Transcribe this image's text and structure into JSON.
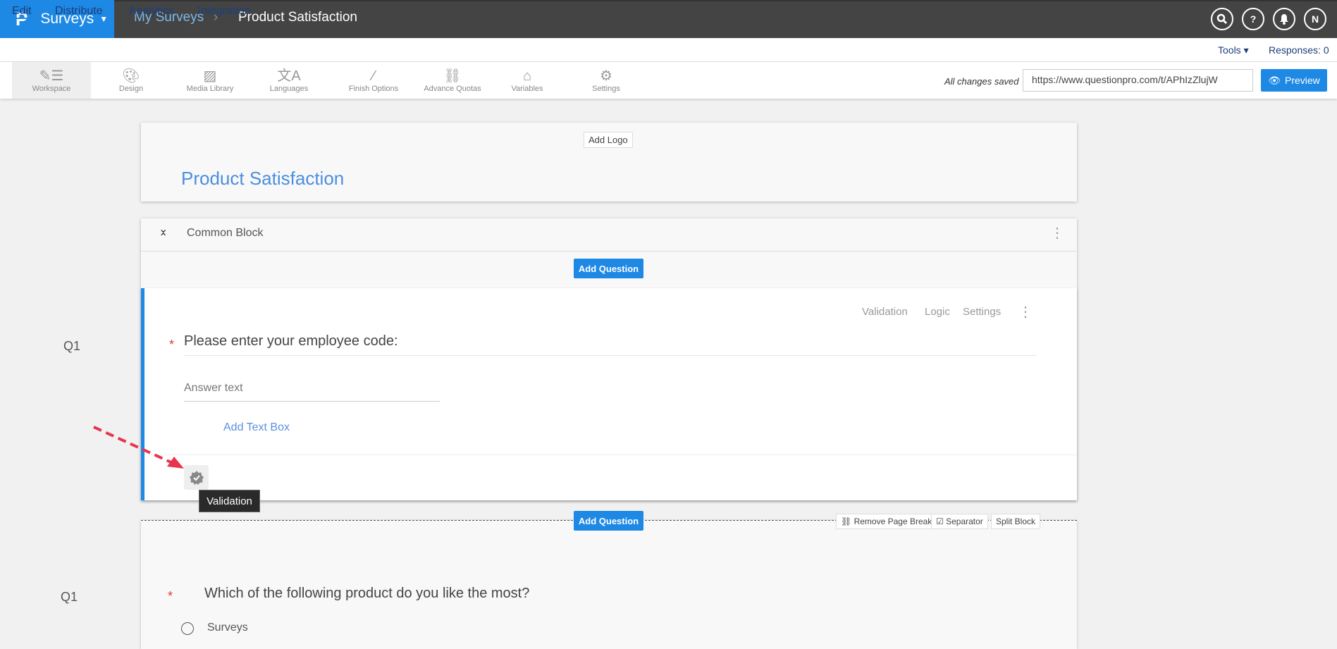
{
  "topbar": {
    "brand": "Surveys",
    "breadcrumb": [
      "My Surveys",
      "Product Satisfaction"
    ],
    "icons": [
      "search-icon",
      "help-icon",
      "bell-icon"
    ],
    "avatar": "N"
  },
  "nav": {
    "tabs": [
      "Edit",
      "Distribute",
      "Analytics",
      "Integration"
    ],
    "tools": "Tools",
    "responses": "Responses: 0"
  },
  "toolbar": {
    "items": [
      "Workspace",
      "Design",
      "Media Library",
      "Languages",
      "Finish Options",
      "Advance Quotas",
      "Variables",
      "Settings"
    ],
    "status": "All changes saved",
    "url": "https://www.questionpro.com/t/APhIzZlujW",
    "preview": "Preview"
  },
  "header": {
    "add_logo": "Add Logo",
    "title": "Product Satisfaction"
  },
  "block": {
    "name": "Common Block",
    "add_question": "Add Question"
  },
  "q1": {
    "number": "Q1",
    "text": "Please enter your employee code:",
    "placeholder": "Answer text",
    "add_text_box": "Add Text Box",
    "actions": [
      "Validation",
      "Logic",
      "Settings"
    ],
    "tooltip": "Validation"
  },
  "page_break": {
    "add_question": "Add Question",
    "remove": "Remove Page Break",
    "separator": "Separator",
    "split": "Split Block"
  },
  "q2": {
    "number": "Q1",
    "text": "Which of the following product do you like the most?",
    "options": [
      "Surveys"
    ]
  },
  "colors": {
    "accent": "#1e88e5",
    "topbar": "#444444",
    "required": "#e53935"
  }
}
